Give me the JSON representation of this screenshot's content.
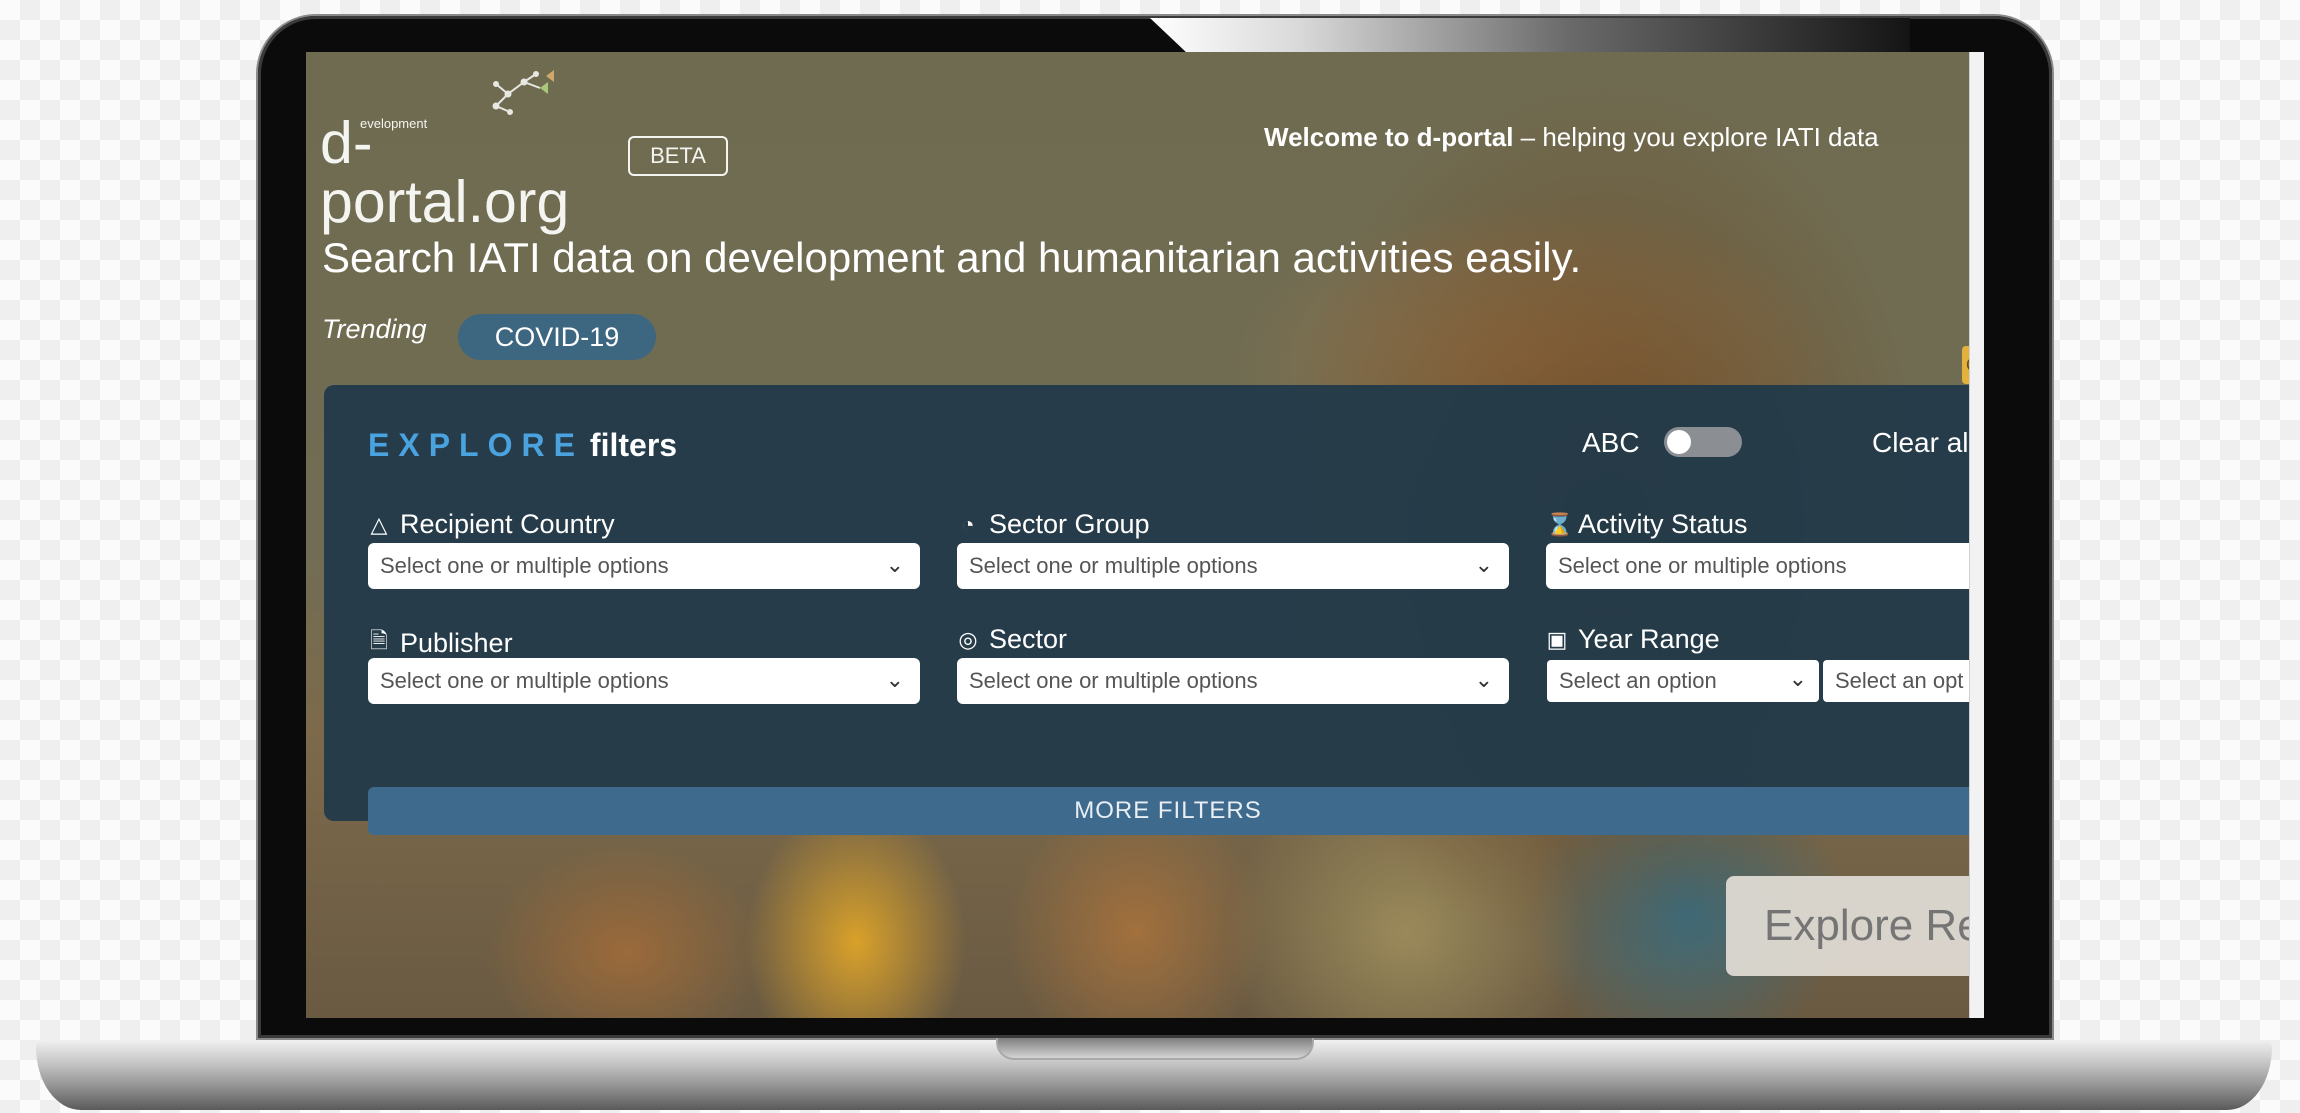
{
  "header": {
    "logo_main": "d-portal.org",
    "logo_superscript": "evelopment",
    "beta_label": "BETA",
    "welcome_bold": "Welcome to d-portal",
    "welcome_rest": " – helping you explore IATI data"
  },
  "hero": {
    "headline": "Search IATI data on development and humanitarian activities easily.",
    "trending_label": "Trending",
    "trending_tag": "COVID-19",
    "side_tab_letter": "G"
  },
  "explore_panel": {
    "title_explore": "EXPLORE",
    "title_filters": "filters",
    "abc_label": "ABC",
    "abc_toggle_on": false,
    "clear_all": "Clear all",
    "filters": {
      "recipient_country": {
        "label": "Recipient Country",
        "icon": "warning-triangle-icon",
        "placeholder": "Select one or multiple options"
      },
      "sector_group": {
        "label": "Sector Group",
        "icon": "pie-icon",
        "placeholder": "Select one or multiple options"
      },
      "activity_status": {
        "label": "Activity Status",
        "icon": "hourglass-icon",
        "placeholder": "Select one or multiple options"
      },
      "publisher": {
        "label": "Publisher",
        "icon": "document-icon",
        "placeholder": "Select one or multiple options"
      },
      "sector": {
        "label": "Sector",
        "icon": "target-icon",
        "placeholder": "Select one or multiple options"
      },
      "year_range": {
        "label": "Year Range",
        "icon": "calendar-icon",
        "from_placeholder": "Select an option",
        "to_placeholder": "Select an opt"
      }
    },
    "more_filters": "MORE FILTERS"
  },
  "explore_button": {
    "label": "Explore Re"
  },
  "colors": {
    "accent_explore": "#4aa3df",
    "panel_bg": "#213949",
    "pill_bg": "#3d6680",
    "more_filters_bg": "#3e6a8e"
  }
}
